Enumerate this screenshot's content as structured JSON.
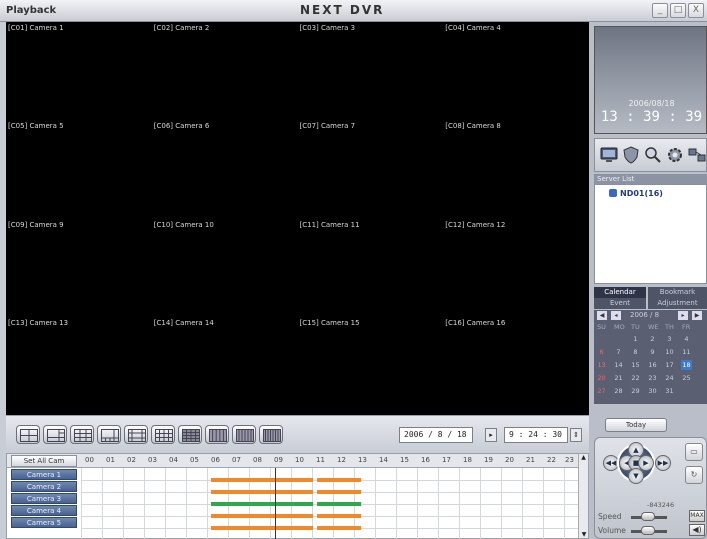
{
  "window": {
    "title": "Playback",
    "brand": "NEXT DVR",
    "controls": [
      "_",
      "□",
      "X"
    ]
  },
  "cameras": [
    "[C01] Camera 1",
    "[C02] Camera 2",
    "[C03] Camera 3",
    "[C04] Camera 4",
    "[C05] Camera 5",
    "[C06] Camera 6",
    "[C07] Camera 7",
    "[C08] Camera 8",
    "[C09] Camera 9",
    "[C10] Camera 10",
    "[C11] Camera 11",
    "[C12] Camera 12",
    "[C13] Camera 13",
    "[C14] Camera 14",
    "[C15] Camera 15",
    "[C16] Camera 16"
  ],
  "search": {
    "date": "2006  /  8  /  18",
    "time": "9  :  24  :  30"
  },
  "timeline": {
    "set_all_label": "Set All Cam",
    "hours": [
      "00",
      "01",
      "02",
      "03",
      "04",
      "05",
      "06",
      "07",
      "08",
      "09",
      "10",
      "11",
      "12",
      "13",
      "14",
      "15",
      "16",
      "17",
      "18",
      "19",
      "20",
      "21",
      "22",
      "23"
    ],
    "rows": [
      "Camera 1",
      "Camera 2",
      "Camera 3",
      "Camera 4",
      "Camera 5"
    ],
    "colors": {
      "recording": "#f08a28",
      "event": "#2ea84a"
    }
  },
  "clock": {
    "date": "2006/08/18",
    "time": "13 : 39 : 39"
  },
  "server_list": {
    "title": "Server List",
    "items": [
      "ND01(16)"
    ]
  },
  "tabs": {
    "calendar": "Calendar",
    "bookmark": "Bookmark",
    "event": "Event",
    "adjustment": "Adjustment"
  },
  "calendar": {
    "year_month": "2006 / 8",
    "weekdays": [
      "SU",
      "MO",
      "TU",
      "WE",
      "TH",
      "FR"
    ],
    "selected_day": "18",
    "weeks": [
      [
        "",
        "",
        "1",
        "2",
        "3",
        "4"
      ],
      [
        "6",
        "7",
        "8",
        "9",
        "10",
        "11"
      ],
      [
        "13",
        "14",
        "15",
        "16",
        "17",
        "18"
      ],
      [
        "20",
        "21",
        "22",
        "23",
        "24",
        "25"
      ],
      [
        "27",
        "28",
        "29",
        "30",
        "31",
        ""
      ]
    ]
  },
  "today_label": "Today",
  "playback": {
    "speed_value": "-843246",
    "speed_label": "Speed",
    "volume_label": "Volume",
    "max_label": "MAX"
  }
}
